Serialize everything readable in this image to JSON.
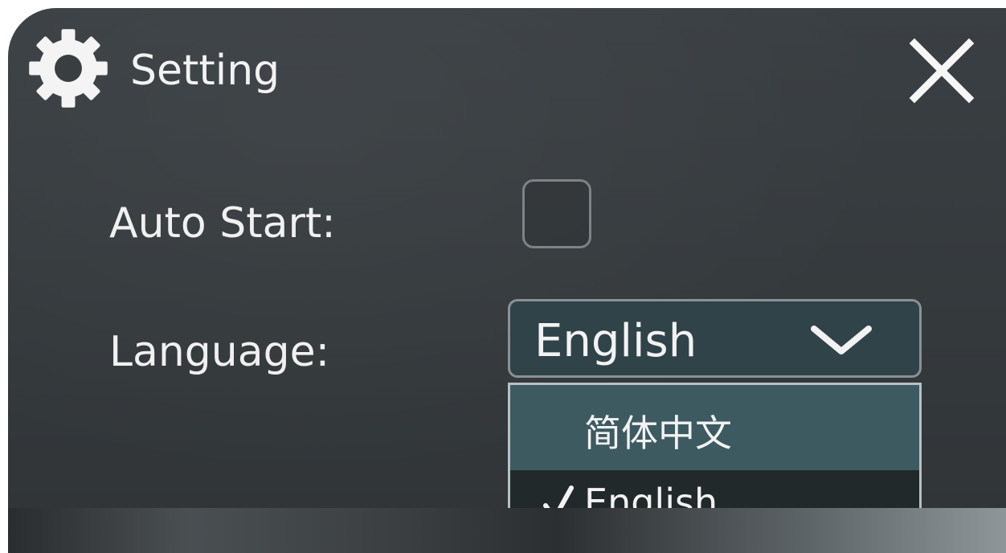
{
  "window": {
    "title": "Setting",
    "icon": "gear-icon",
    "close_icon": "close-icon"
  },
  "form": {
    "auto_start_label": "Auto Start:",
    "auto_start_checked": false,
    "language_label": "Language:",
    "language_value": "English",
    "language_options": [
      {
        "label": "简体中文",
        "selected": false
      },
      {
        "label": "English",
        "selected": true
      }
    ],
    "check_mark": "✓"
  },
  "colors": {
    "window_background": "#363b3e",
    "select_background": "#2f4348",
    "highlight_option": "#3d5a61",
    "selected_option": "#22292b",
    "text": "#f2f2f2"
  }
}
